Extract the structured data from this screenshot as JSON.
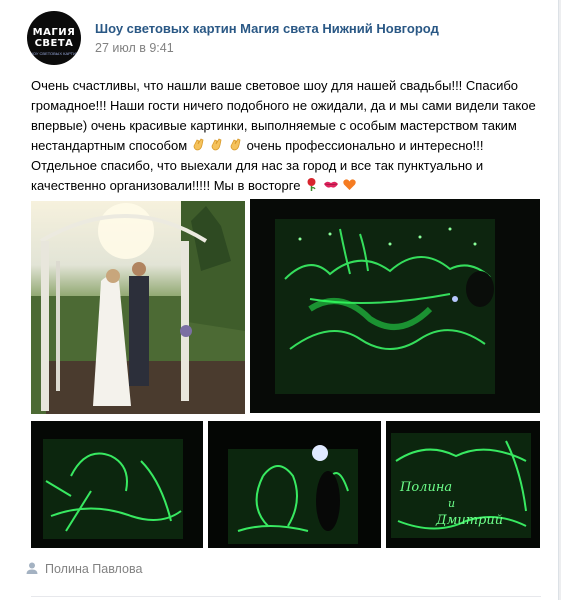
{
  "post": {
    "avatar": {
      "line1": "МАГИЯ",
      "line2": "СВЕТА",
      "tagline": "ШОУ СВЕТОВЫХ КАРТИН"
    },
    "author": "Шоу световых картин Магия света Нижний Новгород",
    "date": "27 июл в 9:41",
    "text_part1": "Очень счастливы, что нашли ваше световое шоу для нашей свадьбы!!! Спасибо громадное!!! Наши гости ничего подобного не ожидали, да и мы сами видели такое впервые) очень красивые картинки, выполняемые с особым мастерством таким нестандартным способом ",
    "text_part2": " очень профессионально и интересно!!! Отдельное спасибо, что выехали для нас за город и все так пунктуально и качественно организовали!!!!! Мы в восторге ",
    "emoji_part1": [
      "clap-icon",
      "clap-icon",
      "clap-icon"
    ],
    "emoji_part2": [
      "rose-icon",
      "kiss-icon",
      "heart-icon"
    ],
    "signature": "Полина Павлова",
    "colors": {
      "link": "#2a5885",
      "meta": "#828282",
      "glow": "#3dff6a"
    },
    "photos": [
      {
        "name": "wedding-couple-photo"
      },
      {
        "name": "light-show-landscape-photo"
      },
      {
        "name": "light-show-portrait-photo"
      },
      {
        "name": "light-show-couple-photo"
      },
      {
        "name": "light-show-names-photo",
        "text": "Полина и Дмитрий"
      }
    ]
  }
}
